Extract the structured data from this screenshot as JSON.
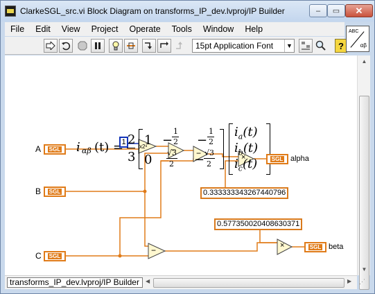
{
  "window": {
    "title": "ClarkeSGL_src.vi Block Diagram on transforms_IP_dev.lvproj/IP Builder",
    "buttons": {
      "minimize": "–",
      "maximize": "▭",
      "close": "✕"
    }
  },
  "menu": [
    "File",
    "Edit",
    "View",
    "Project",
    "Operate",
    "Tools",
    "Window",
    "Help"
  ],
  "toolbar": {
    "font": "15pt Application Font",
    "icons": [
      "run-arrow-icon",
      "run-continuously-icon",
      "abort-icon",
      "pause-icon",
      "highlight-execution-icon",
      "retain-wire-values-icon",
      "step-into-icon",
      "step-over-icon",
      "step-out-icon",
      "align-icon",
      "search-icon",
      "help-icon"
    ],
    "help_label": "?"
  },
  "context_icon": {
    "top": "ABC",
    "bottom": "αβ"
  },
  "diagram": {
    "formula": {
      "lhs": "i",
      "lhs_sub": "αβ",
      "lhs_arg": "(t) =",
      "fraction": {
        "num": "2",
        "den": "3"
      },
      "matrix": {
        "row1": [
          "1",
          "−",
          "−"
        ],
        "row1_frac": [
          {
            "num": "1",
            "den": "2"
          },
          {
            "num": "1",
            "den": "2"
          }
        ],
        "row2": [
          "0",
          "",
          "−"
        ],
        "row2_frac": [
          {
            "num": "√3",
            "den": "2"
          },
          {
            "num": "√3",
            "den": "2"
          }
        ]
      },
      "vector": [
        "a",
        "b",
        "c"
      ],
      "vector_prefix": "i",
      "vector_arg": "(t)"
    },
    "inputs": [
      {
        "label": "A",
        "type": "SGL"
      },
      {
        "label": "B",
        "type": "SGL"
      },
      {
        "label": "C",
        "type": "SGL"
      }
    ],
    "outputs": [
      {
        "label": "alpha",
        "type": "SGL"
      },
      {
        "label": "beta",
        "type": "SGL"
      }
    ],
    "constants": {
      "int_one": "1",
      "third": "0.333333343267440796",
      "inv_sqrt3": "0.577350020408630371"
    },
    "operators": {
      "scale": "x2ⁿ",
      "subtract": "−",
      "multiply": "×"
    }
  },
  "status": {
    "path": "transforms_IP_dev.lvproj/IP Builder"
  },
  "colors": {
    "wire": "#e07b18",
    "int_constant": "#1233b8",
    "titlebar": "#c9d9ec"
  }
}
